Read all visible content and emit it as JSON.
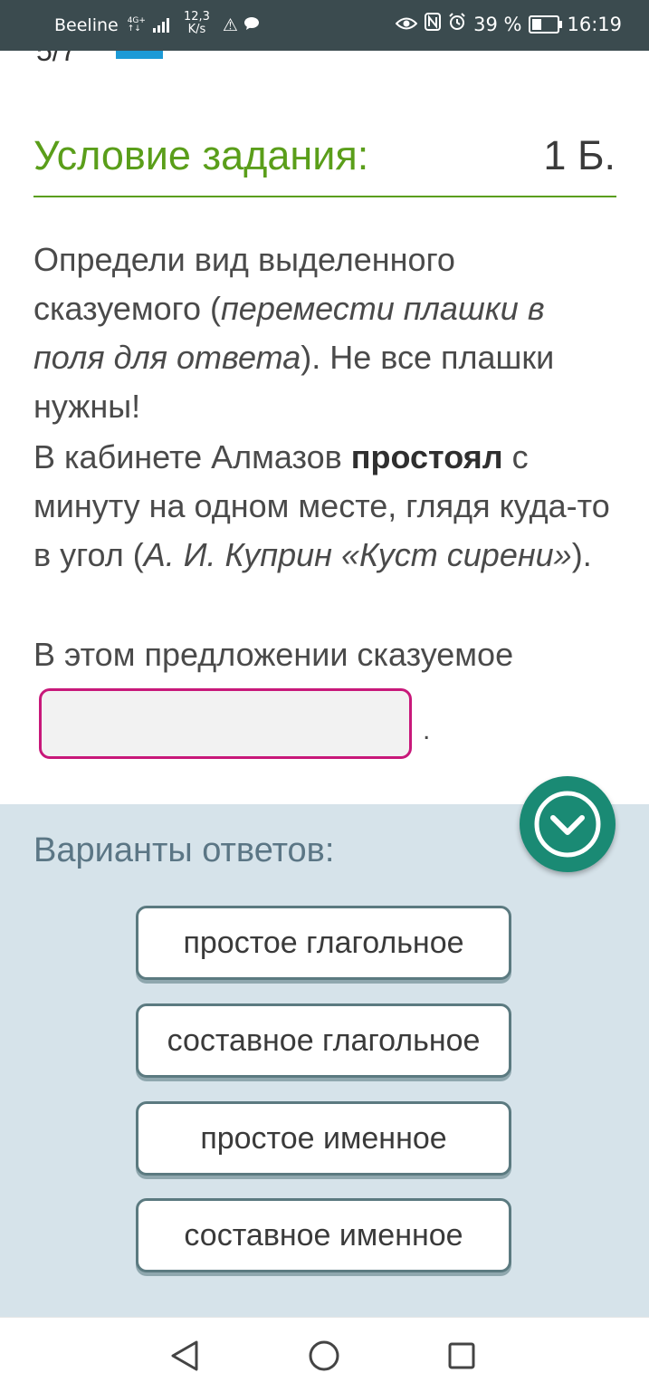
{
  "status_bar": {
    "carrier": "Beeline",
    "network": "4G+",
    "speed_value": "12,3",
    "speed_unit": "K/s",
    "battery": "39 %",
    "time": "16:19"
  },
  "task": {
    "title": "Условие задания:",
    "points": "1 Б.",
    "instruction_1": "Определи вид выделенного сказуемого (",
    "instruction_italic": "перемести плашки в поля для ответа",
    "instruction_2": "). Не все плашки нужны!",
    "sentence_1": "В кабинете Алмазов ",
    "sentence_bold": "простоял",
    "sentence_2": " с минуту на одном месте, глядя куда-то в угол (",
    "sentence_source": "А. И. Куприн «Куст сирени»",
    "sentence_3": ").",
    "answer_prompt": "В этом предложении сказуемое",
    "period": "."
  },
  "answers": {
    "title": "Варианты ответов:",
    "options": [
      "простое глагольное",
      "составное глагольное",
      "простое именное",
      "составное именное"
    ]
  },
  "colors": {
    "accent_green": "#5a9e1a",
    "dropzone_border": "#c8187a",
    "answers_bg": "#d6e3ea",
    "fab": "#1a8a74"
  }
}
